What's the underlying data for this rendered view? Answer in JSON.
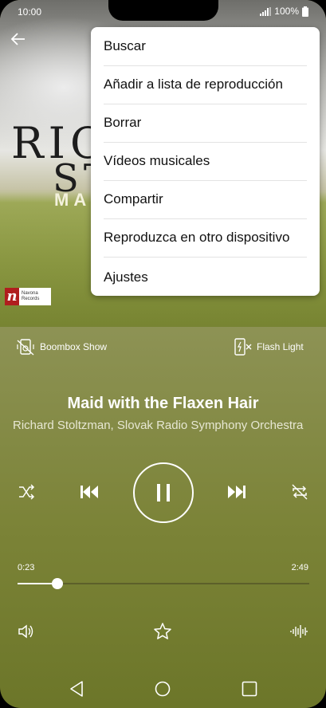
{
  "status_bar": {
    "time": "10:00",
    "battery": "100%"
  },
  "menu": {
    "items": [
      {
        "label": "Buscar"
      },
      {
        "label": "Añadir a lista de reproducción"
      },
      {
        "label": "Borrar"
      },
      {
        "label": "Vídeos musicales"
      },
      {
        "label": "Compartir"
      },
      {
        "label": "Reproduzca en otro dispositivo"
      },
      {
        "label": "Ajustes"
      }
    ]
  },
  "album_art": {
    "line1": "RIC",
    "line2": "ST",
    "line3": "MAI",
    "logo_brand": "Navona",
    "logo_sub": "Records"
  },
  "toolbar": {
    "boombox_label": "Boombox Show",
    "flash_label": "Flash Light"
  },
  "track": {
    "title": "Maid with the Flaxen Hair",
    "artist": "Richard Stoltzman, Slovak Radio Symphony Orchestra",
    "elapsed": "0:23",
    "duration": "2:49",
    "progress_fraction": 0.136
  },
  "icons": {
    "back": "arrow-left-icon",
    "shuffle": "shuffle-icon",
    "previous": "skip-previous-icon",
    "pause": "pause-icon",
    "next": "skip-next-icon",
    "repeat": "repeat-off-icon",
    "volume": "volume-icon",
    "favorite": "star-icon",
    "equalizer": "equalizer-icon"
  }
}
